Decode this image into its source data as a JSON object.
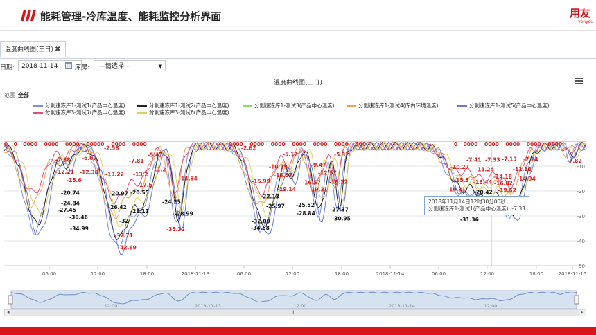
{
  "header": {
    "title": "能耗管理-冷库温度、能耗监控分析界面",
    "logo_text": "用友",
    "logo_sub": "yonyou",
    "brand_color": "#d8141b"
  },
  "tabs": [
    {
      "label": "温度曲线图(三日)",
      "close": "✖"
    }
  ],
  "filters": {
    "date_label": "日期:",
    "date_value": "2018-11-14",
    "calendar_icon": "calendar-icon",
    "warehouse_label": "库房:",
    "warehouse_value": "---请选择---"
  },
  "chart": {
    "title": "温度曲线图(三日)",
    "range_label": "范围",
    "range_value": "全部",
    "tooltip_time": "2018年11月14日12时30分00秒",
    "tooltip_series": "分割速冻库1-测试1(产品中心温度): -7.33",
    "legend": [
      {
        "name": "分割速冻库1-测试1(产品中心温度)",
        "color": "#7a8fe0"
      },
      {
        "name": "分割速冻库1-测试2(产品中心温度)",
        "color": "#222222"
      },
      {
        "name": "分割速冻库1-测试3(产品中心温度)",
        "color": "#8fd870"
      },
      {
        "name": "分割速冻库1-测试4(库内环境温度)",
        "color": "#f0a050"
      },
      {
        "name": "分割速冻库1-测试5(产品中心温度)",
        "color": "#6677dd"
      },
      {
        "name": "分割速冻库3-测试7(产品中心温度)",
        "color": "#e0507a"
      },
      {
        "name": "分割速冻库3-测试6(产品中心温度)",
        "color": "#e0d060"
      }
    ],
    "navigator_labels": [
      "12:00",
      "2018-11-13",
      "12:00",
      "2018-11-14",
      "12:00"
    ],
    "navigator_mid": "III"
  },
  "chart_data": {
    "type": "line",
    "title": "温度曲线图(三日)",
    "x_ticks": [
      "06:00",
      "12:00",
      "18:00",
      "2018-11-13",
      "06:00",
      "12:00",
      "18:00",
      "2018-11-14",
      "06:00",
      "12:00",
      "18:00",
      "2018-11-15"
    ],
    "y_ticks": [
      -10,
      -20,
      -30,
      -40,
      -50
    ],
    "ylim": [
      -50,
      0
    ],
    "zero_label_row": [
      "0",
      "0",
      "0000",
      "0000",
      "0000",
      "00000",
      "0000",
      "0000",
      "0000",
      "0000",
      "0000",
      "0000",
      "0000",
      "0000",
      "000",
      "0",
      "0000",
      "0000",
      "0000",
      "0000",
      "0000",
      "0000",
      "000",
      "000",
      "0000",
      "0000",
      "0000",
      "00000",
      "0000",
      "0000"
    ],
    "red_labels": [
      "-7.38",
      "-12.21",
      "-15.6",
      "-6.67",
      "-12.38",
      "-2.58",
      "-13.22",
      "-7.81",
      "-13.2",
      "-17.5",
      "-5.47",
      "-11.2",
      "-14.84",
      "-37.71",
      "-42.69",
      "-35.32",
      "-2.62",
      "-15.99",
      "-10.19",
      "-13.57",
      "-19.14",
      "-5.17",
      "-9.47",
      "-12.57",
      "-16.57",
      "-19.31",
      "-16.22",
      "-5.32",
      "-10.27",
      "-15.5",
      "-19.31",
      "-7.41",
      "-11.24",
      "-16.44",
      "-7.33",
      "-7.13",
      "-14.18",
      "-16.82",
      "-19.62",
      "-11.18",
      "-14.94",
      "-7.24",
      "-7.82"
    ],
    "black_labels": [
      "-20.74",
      "-24.84",
      "-27.45",
      "-30.46",
      "-34.99",
      "-20.97",
      "-26.42",
      "-32",
      "-20.55",
      "-28.11",
      "-24.25",
      "-28.99",
      "-22.13",
      "-25.97",
      "-32.09",
      "-34.68",
      "-25.52",
      "-28.84",
      "-27.37",
      "-30.95",
      "-20.42",
      "-31.36"
    ]
  },
  "page": {
    "bottom_bar_color": "#d8141b"
  }
}
